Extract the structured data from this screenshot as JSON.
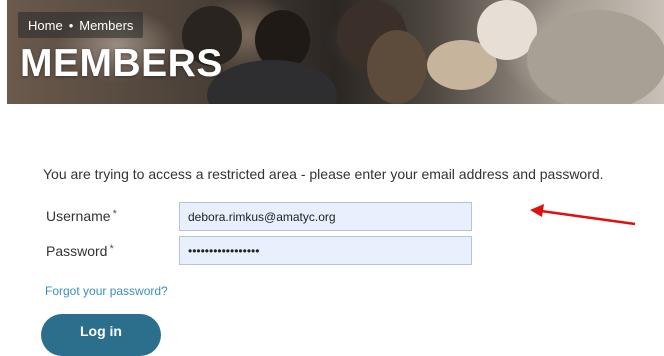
{
  "breadcrumb": {
    "home": "Home",
    "separator": "•",
    "current": "Members"
  },
  "hero": {
    "title": "MEMBERS"
  },
  "login": {
    "notice": "You are trying to access a restricted area - please enter your email address and password.",
    "username_label": "Username",
    "username_value": "debora.rimkus@amatyc.org",
    "password_label": "Password",
    "password_masked": "•••••••••••••••••",
    "required_mark": "*",
    "forgot_link": "Forgot your password?",
    "submit_label": "Log in"
  },
  "colors": {
    "button": "#2b6f8c",
    "link": "#3a8fc0",
    "input_fill": "#e8f0fe",
    "annotation_arrow": "#e01010"
  },
  "annotation": {
    "type": "arrow",
    "points_to": "username-field"
  }
}
